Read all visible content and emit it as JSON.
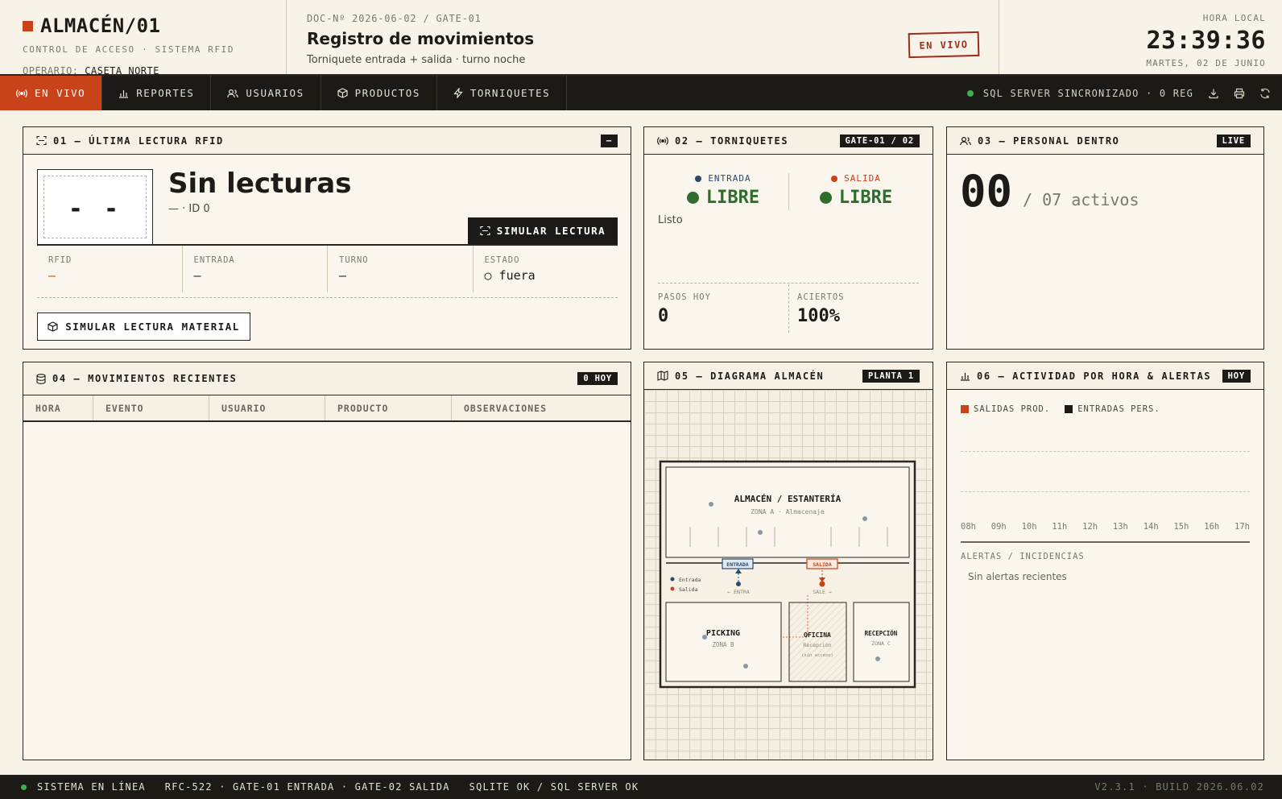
{
  "header": {
    "brand_title": "ALMACÉN/01",
    "brand_subtitle": "CONTROL DE ACCESO · SISTEMA RFID",
    "operator_label": "OPERARIO:",
    "operator_value": "CASETA NORTE",
    "doc_ref": "DOC-Nº 2026-06-02 / GATE-01",
    "doc_title": "Registro de movimientos",
    "doc_subtitle": "Torniquete entrada + salida · turno noche",
    "live_stamp": "EN VIVO",
    "clock_label": "HORA LOCAL",
    "clock_time": "23:39:36",
    "clock_date": "MARTES, 02 DE JUNIO"
  },
  "nav": {
    "tabs": [
      {
        "label": "EN VIVO",
        "icon": "broadcast-icon"
      },
      {
        "label": "REPORTES",
        "icon": "bar-chart-icon"
      },
      {
        "label": "USUARIOS",
        "icon": "users-icon"
      },
      {
        "label": "PRODUCTOS",
        "icon": "box-icon"
      },
      {
        "label": "TORNIQUETES",
        "icon": "bolt-icon"
      }
    ],
    "sync_status": "SQL SERVER SINCRONIZADO · 0 REG"
  },
  "panel1": {
    "title": "01 — ÚLTIMA LECTURA RFID",
    "badge": "—",
    "rfid_placeholder": "- -",
    "reading_title": "Sin lecturas",
    "reading_sub": "— · ID 0",
    "sim_button": "SIMULAR LECTURA",
    "fields": [
      {
        "label": "RFID",
        "value": "—"
      },
      {
        "label": "ENTRADA",
        "value": "—"
      },
      {
        "label": "TURNO",
        "value": "—"
      },
      {
        "label": "ESTADO",
        "value": "○ fuera"
      }
    ],
    "sim_material_button": "SIMULAR LECTURA MATERIAL"
  },
  "panel2": {
    "title": "02 — TORNIQUETES",
    "badge": "GATE-01 / 02",
    "entry_label": "ENTRADA",
    "entry_state": "LIBRE",
    "exit_label": "SALIDA",
    "exit_state": "LIBRE",
    "ready_text": "Listo",
    "steps_label": "PASOS HOY",
    "steps_value": "0",
    "hits_label": "ACIERTOS",
    "hits_value": "100%"
  },
  "panel3": {
    "title": "03 — PERSONAL DENTRO",
    "badge": "LIVE",
    "count": "00",
    "of_text": "/ 07 activos"
  },
  "panel4": {
    "title": "04 — MOVIMIENTOS RECIENTES",
    "badge": "0 HOY",
    "columns": [
      "HORA",
      "EVENTO",
      "USUARIO",
      "PRODUCTO",
      "OBSERVACIONES"
    ]
  },
  "panel5": {
    "title": "05 — DIAGRAMA ALMACÉN",
    "badge": "PLANTA 1",
    "zone_storage": "ALMACÉN / ESTANTERÍA",
    "zone_storage_sub": "ZONA A · Almacenaje",
    "gate_entry": "ENTRADA",
    "gate_exit": "SALIDA",
    "legend_entry": "Entrada",
    "legend_exit": "Salida",
    "arrow_entry": "← ENTRA",
    "arrow_exit": "SALE →",
    "zone_picking": "PICKING",
    "zone_picking_sub": "ZONA B",
    "zone_office": "OFICINA",
    "zone_office_sub": "Recepción",
    "zone_office_note": "(sin acceso)",
    "zone_reception": "RECEPCIÓN",
    "zone_reception_sub": "ZONA C"
  },
  "panel6": {
    "title": "06 — ACTIVIDAD POR HORA & ALERTAS",
    "badge": "HOY",
    "legend_exits": "SALIDAS PROD.",
    "legend_entries": "ENTRADAS PERS.",
    "hours": [
      "08h",
      "09h",
      "10h",
      "11h",
      "12h",
      "13h",
      "14h",
      "15h",
      "16h",
      "17h"
    ],
    "alerts_title": "ALERTAS / INCIDENCIAS",
    "alerts_empty": "Sin alertas recientes"
  },
  "footer": {
    "system": "SISTEMA EN LÍNEA",
    "devices": "RFC-522 · GATE-01 ENTRADA · GATE-02 SALIDA",
    "db": "SQLITE OK / SQL SERVER OK",
    "version": "V2.3.1 · BUILD 2026.06.02"
  },
  "colors": {
    "accent": "#c8421a",
    "dark": "#1b1a17",
    "paper": "#f7f2e6",
    "ok_green": "#2f6d2f",
    "entry_blue": "#2d4a6b"
  }
}
